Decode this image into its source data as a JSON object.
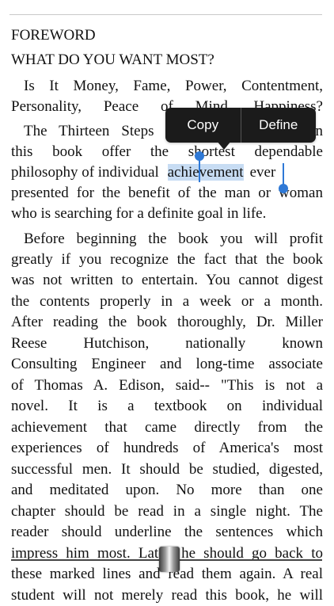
{
  "reader": {
    "heading1": "FOREWORD",
    "heading2": "WHAT DO YOU WANT MOST?",
    "p1_l1": "Is It Money, Fame, Power, Contentment,",
    "p1_l2": "Personality, Peace of Mind, Happiness?",
    "p2_l1": "The Thirteen Steps to Riches described in",
    "p2_l2": "this book offer the shortest dependable",
    "p2_l3_a": "philosophy of individual",
    "p2_l3_sel": "achievement",
    "p2_l3_b": "ever",
    "p2_l4": "presented for the benefit of the man or woman",
    "p2_l5": "who is searching for a definite goal in life.",
    "p3_l1": "Before beginning the book you will profit",
    "p3_l2": "greatly if you recognize the fact that the book",
    "p3_l3": "was not written to entertain. You cannot digest",
    "p3_l4": "the contents properly in a week or a month.",
    "p3_l5": "After reading the book thoroughly, Dr. Miller",
    "p3_l6": "Reese Hutchison, nationally known",
    "p3_l7": "Consulting Engineer and long-time associate",
    "p3_l8": "of Thomas A. Edison, said-- \"This is not a",
    "p3_l9": "novel. It is a textbook on individual",
    "p3_l10": "achievement that came directly from the",
    "p3_l11": "experiences of hundreds of America's most",
    "p3_l12": "successful men. It should be studied, digested,",
    "p3_l13": "and meditated upon. No more than one",
    "p3_l14": "chapter should be read in a single night. The",
    "p3_l15": "reader should underline the sentences which",
    "p3_l16": "impress him most. Later, he should go back to",
    "p3_l17": "these marked lines and read them again. A real",
    "p3_l18": "student will not merely read this book, he will"
  },
  "context_menu": {
    "copy_label": "Copy",
    "define_label": "Define"
  },
  "page_slider": {
    "position_fraction": 0.5
  }
}
